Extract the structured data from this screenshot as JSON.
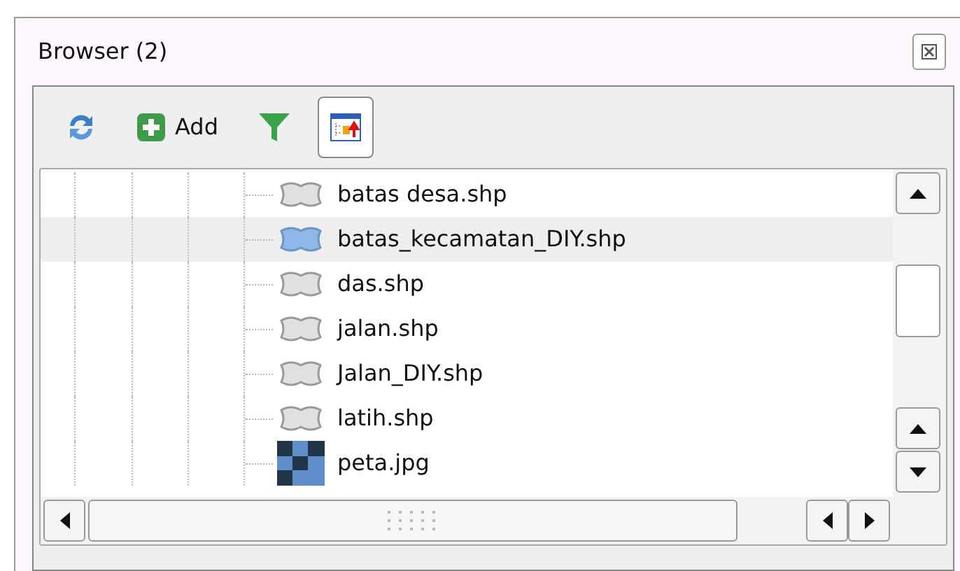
{
  "panel": {
    "title": "Browser (2)"
  },
  "toolbar": [
    {
      "kind": "refresh",
      "pressed": false
    },
    {
      "kind": "add",
      "label": "Add",
      "pressed": false
    },
    {
      "kind": "filter",
      "pressed": false
    },
    {
      "kind": "collapse",
      "pressed": true
    }
  ],
  "tree": {
    "items": [
      {
        "label": "batas desa.shp",
        "kind": "vector",
        "selected": false
      },
      {
        "label": "batas_kecamatan_DIY.shp",
        "kind": "vector",
        "selected": true
      },
      {
        "label": "das.shp",
        "kind": "vector",
        "selected": false
      },
      {
        "label": "jalan.shp",
        "kind": "vector",
        "selected": false
      },
      {
        "label": "Jalan_DIY.shp",
        "kind": "vector",
        "selected": false
      },
      {
        "label": "latih.shp",
        "kind": "vector",
        "selected": false
      },
      {
        "label": "peta.jpg",
        "kind": "raster",
        "selected": false
      }
    ]
  }
}
